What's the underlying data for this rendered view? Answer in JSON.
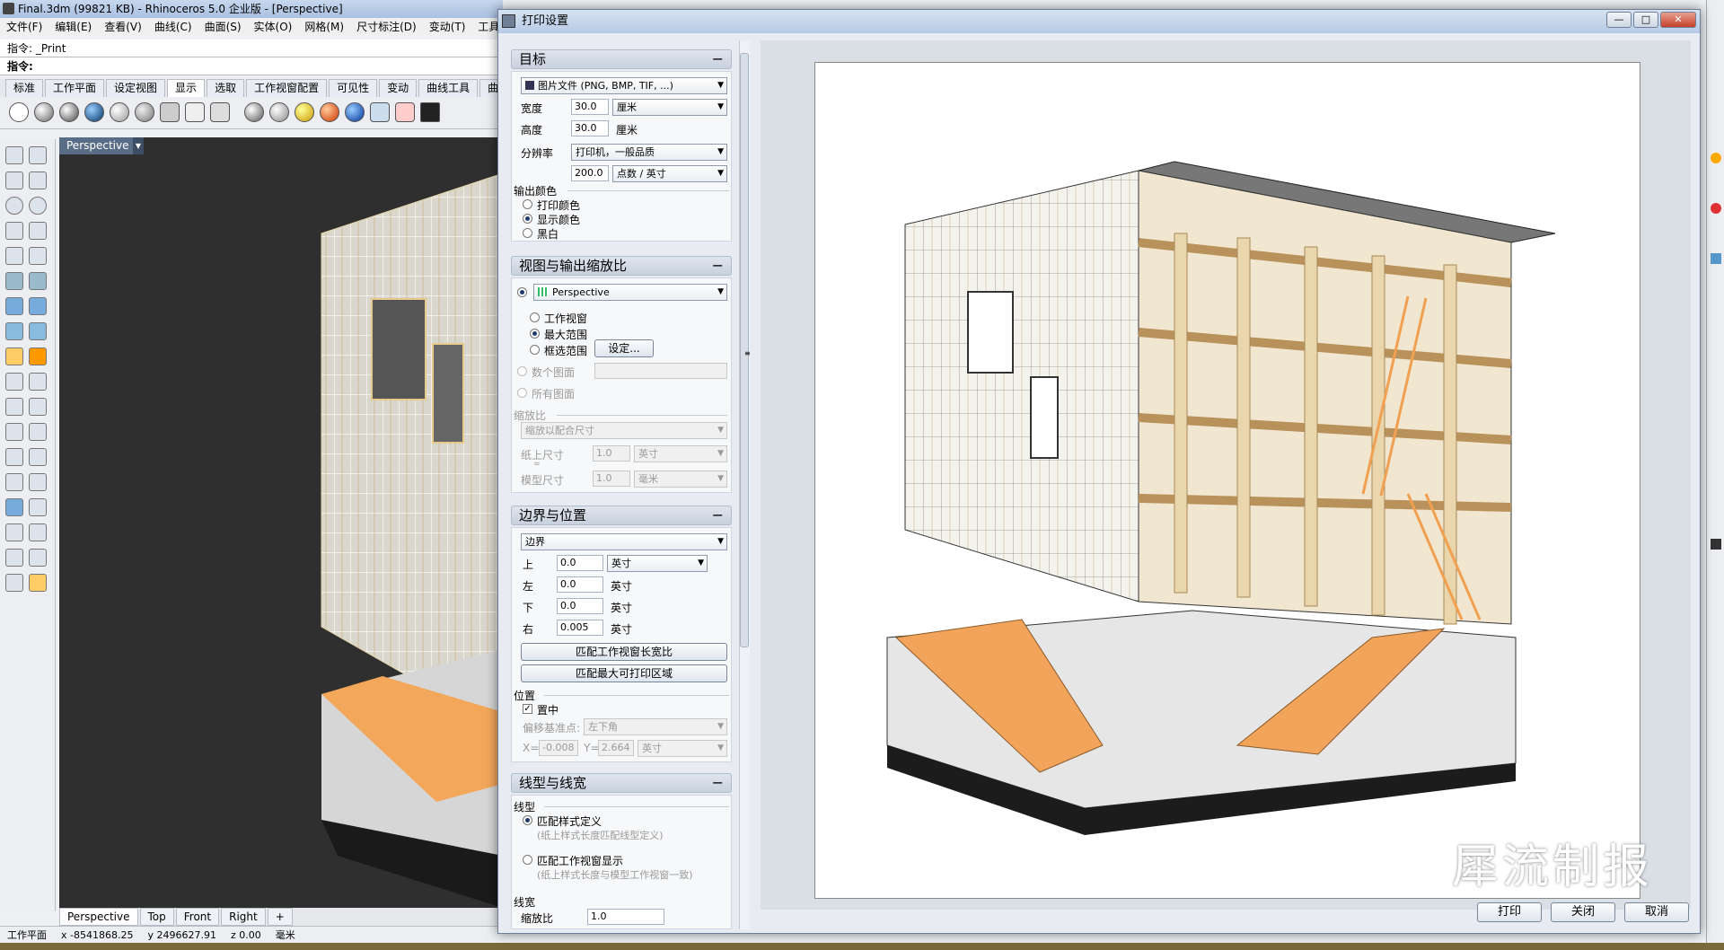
{
  "rhino": {
    "title": "Final.3dm (99821 KB) - Rhinoceros  5.0 企业版 - [Perspective]",
    "menu": [
      "文件(F)",
      "编辑(E)",
      "查看(V)",
      "曲线(C)",
      "曲面(S)",
      "实体(O)",
      "网格(M)",
      "尺寸标注(D)",
      "变动(T)",
      "工具("
    ],
    "command_history": "指令: _Print",
    "command_prompt": "指令:",
    "toolbar_tabs": [
      "标准",
      "工作平面",
      "设定视图",
      "显示",
      "选取",
      "工作视窗配置",
      "可见性",
      "变动",
      "曲线工具",
      "曲面"
    ],
    "active_toolbar_tab": "显示",
    "viewport_name": "Perspective",
    "viewport_tabs": [
      "Perspective",
      "Top",
      "Front",
      "Right"
    ],
    "add_tab": "+",
    "status": {
      "cplane": "工作平面",
      "x": "x -8541868.25",
      "y": "y 2496627.91",
      "z": "z 0.00",
      "unit": "毫米"
    }
  },
  "dialog": {
    "title": "打印设置",
    "target": {
      "heading": "目标",
      "type": "图片文件 (PNG, BMP, TIF, ...)",
      "width_label": "宽度",
      "width_value": "30.0",
      "width_unit": "厘米",
      "height_label": "高度",
      "height_value": "30.0",
      "height_unit": "厘米",
      "resolution_label": "分辨率",
      "resolution_preset": "打印机，一般品质",
      "dpi_value": "200.0",
      "dpi_unit": "点数 / 英寸",
      "output_color_label": "输出颜色",
      "color_options": [
        "打印颜色",
        "显示颜色",
        "黑白"
      ],
      "color_selected": 1
    },
    "view": {
      "heading": "视图与输出缩放比",
      "view_selected": "Perspective",
      "area_options": [
        "工作视窗",
        "最大范围",
        "框选范围"
      ],
      "area_selected": 1,
      "set_button": "设定...",
      "multi_pages": "数个图面",
      "all_pages": "所有图面",
      "scale_label": "缩放比",
      "scale_mode": "缩放以配合尺寸",
      "paper_size_label": "纸上尺寸",
      "paper_size_value": "1.0",
      "paper_size_unit": "英寸",
      "equals": "=",
      "model_size_label": "模型尺寸",
      "model_size_value": "1.0",
      "model_size_unit": "毫米"
    },
    "margins": {
      "heading": "边界与位置",
      "mode": "边界",
      "top_label": "上",
      "top_value": "0.0",
      "unit_select": "英寸",
      "left_label": "左",
      "left_value": "0.0",
      "left_unit": "英寸",
      "bottom_label": "下",
      "bottom_value": "0.0",
      "bottom_unit": "英寸",
      "right_label": "右",
      "right_value": "0.005",
      "right_unit": "英寸",
      "match_viewport_button": "匹配工作视窗长宽比",
      "match_max_button": "匹配最大可打印区域",
      "position_label": "位置",
      "center_label": "置中",
      "center_checked": true,
      "offset_label": "偏移基准点:",
      "offset_value": "左下角",
      "x_label": "X=",
      "x_value": "-0.008",
      "y_label": "Y=",
      "y_value": "2.664",
      "xy_unit": "英寸"
    },
    "linetype": {
      "heading": "线型与线宽",
      "linetype_label": "线型",
      "opt1": "匹配样式定义",
      "opt1_desc": "(纸上样式长度匹配线型定义)",
      "opt2": "匹配工作视窗显示",
      "opt2_desc": "(纸上样式长度与模型工作视窗一致)",
      "lineweight_label": "线宽",
      "scale_label": "缩放比",
      "scale_value": "1.0"
    },
    "buttons": {
      "print": "打印",
      "close": "关闭",
      "cancel": "取消"
    }
  },
  "watermark": "犀流制报"
}
